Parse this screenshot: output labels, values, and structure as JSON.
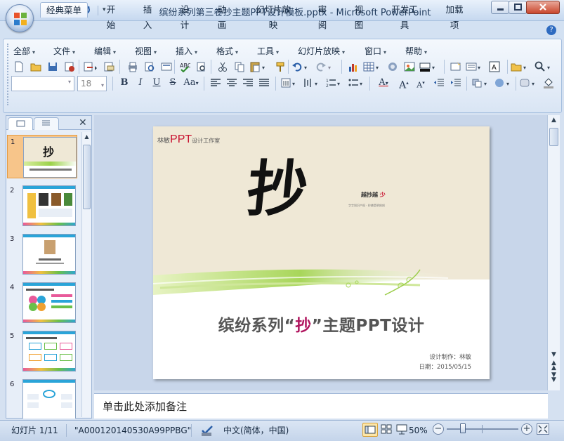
{
  "window": {
    "title": "缤纷系列第三卷抄主题PPT设计模板.pptx - Microsoft PowerPoint"
  },
  "tabs": [
    {
      "label": "经典菜单",
      "active": true
    },
    {
      "label": "开始"
    },
    {
      "label": "插入"
    },
    {
      "label": "设计"
    },
    {
      "label": "动画"
    },
    {
      "label": "幻灯片放映"
    },
    {
      "label": "审阅"
    },
    {
      "label": "视图"
    },
    {
      "label": "开发工具"
    },
    {
      "label": "加载项"
    }
  ],
  "menus": [
    "全部",
    "文件",
    "编辑",
    "视图",
    "插入",
    "格式",
    "工具",
    "幻灯片放映",
    "窗口",
    "帮助"
  ],
  "format_bar": {
    "font_size": "18",
    "bold": "B",
    "italic": "I",
    "underline": "U",
    "strike": "S",
    "change_case": "Aa",
    "font_color": "A",
    "grow_font": "A",
    "shrink_font": "A"
  },
  "slides_panel": {
    "numbers": [
      "1",
      "2",
      "3",
      "4",
      "5",
      "6"
    ]
  },
  "slide": {
    "studio_prefix": "林敏",
    "studio_ppt": "PPT",
    "studio_suffix": "设计工作室",
    "calligraphy": "抄",
    "slogan_a": "越抄越",
    "slogan_b": "少",
    "tagline": "字字知识产权 · 抄袭是明刻刻",
    "main_title_a": "缤纷系列",
    "main_title_q1": "“",
    "main_title_key": "抄",
    "main_title_q2": "”",
    "main_title_b": "主题PPT设计",
    "designer": "设计制作：林敏",
    "date": "日期：2015/05/15"
  },
  "notes": {
    "placeholder": "单击此处添加备注"
  },
  "status": {
    "slide_counter": "幻灯片 1/11",
    "theme": "\"A000120140530A99PPBG\"",
    "language": "中文(简体，中国)",
    "zoom": "50%",
    "zoom_level": 0.5
  },
  "colors": {
    "accent_red": "#c8102e",
    "accent_magenta": "#b0145e",
    "ribbon_blue": "#d3e1f2",
    "slide_paper": "#efe8d6"
  }
}
